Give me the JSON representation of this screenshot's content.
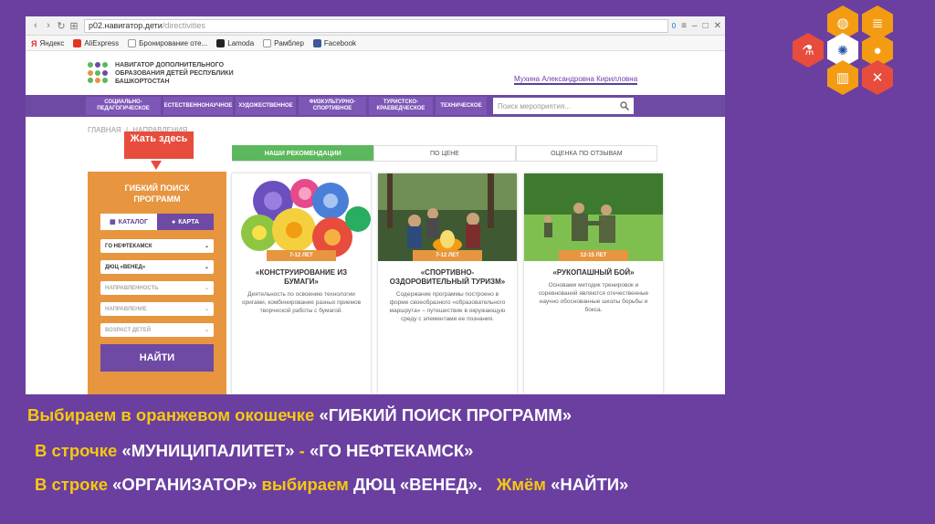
{
  "browser": {
    "url_host": "p02.навигатор.дети",
    "url_path": "/directivities",
    "bookmarks": [
      "Яндекс",
      "AliExpress",
      "Бронирование оте...",
      "Lamoda",
      "Рамблер",
      "Facebook"
    ],
    "counter": "0"
  },
  "site": {
    "logo_line1": "НАВИГАТОР ДОПОЛНИТЕЛЬНОГО",
    "logo_line2": "ОБРАЗОВАНИЯ ДЕТЕЙ РЕСПУБЛИКИ",
    "logo_line3": "БАШКОРТОСТАН",
    "user_name": "Мухина Александровна Кирилловна"
  },
  "categories": [
    "Социально-педагогическое",
    "Естественнонаучное",
    "Художественное",
    "Физкультурно-спортивное",
    "Туристско-краеведческое",
    "Техническое"
  ],
  "search": {
    "placeholder": "Поиск мероприятия..."
  },
  "breadcrumb": {
    "home": "ГЛАВНАЯ",
    "sep": "|",
    "current": "НАПРАВЛЕНИЯ"
  },
  "annotation": "Жать здесь",
  "sidebar": {
    "title": "ГИБКИЙ ПОИСК ПРОГРАММ",
    "catalog": "КАТАЛОГ",
    "map": "КАРТА",
    "municipality": "ГО НЕФТЕКАМСК",
    "organizer": "ДЮЦ «ВЕНЕД»",
    "direction": "НАПРАВЛЕННОСТЬ",
    "branch": "НАПРАВЛЕНИЕ",
    "age": "ВОЗРАСТ ДЕТЕЙ",
    "find": "НАЙТИ"
  },
  "tabs": [
    "НАШИ РЕКОМЕНДАЦИИ",
    "ПО ЦЕНЕ",
    "ОЦЕНКА ПО ОТЗЫВАМ"
  ],
  "cards": [
    {
      "age": "7-12 ЛЕТ",
      "title": "«КОНСТРУИРОВАНИЕ ИЗ БУМАГИ»",
      "desc": "Деятельность по освоению технологии оригами, комбинирование разных приемов творческой работы с бумагой."
    },
    {
      "age": "7-12 ЛЕТ",
      "title": "«СПОРТИВНО-ОЗДОРОВИТЕЛЬНЫЙ ТУРИЗМ»",
      "desc": "Содержание программы построено в форме своеобразного «образовательного маршрута» – путешествие в окружающую среду с элементами ее познания."
    },
    {
      "age": "12-15 ЛЕТ",
      "title": "«РУКОПАШНЫЙ БОЙ»",
      "desc": "Основами методик тренировок и соревнований являются отечественные научно обоснованные школы борьбы и бокса."
    }
  ],
  "instructions": {
    "line1_a": "Выбираем в оранжевом окошечке ",
    "line1_b": "«ГИБКИЙ ПОИСК ПРОГРАММ»",
    "line2_a": "В строчке ",
    "line2_b": "«МУНИЦИПАЛИТЕТ»",
    "line2_c": " - ",
    "line2_d": "«ГО НЕФТЕКАМСК»",
    "line3_a": "В строке ",
    "line3_b": "«ОРГАНИЗАТОР»",
    "line3_c": " выбираем ",
    "line3_d": "ДЮЦ «ВЕНЕД».",
    "line3_e": "   Жмём ",
    "line3_f": "«НАЙТИ»"
  },
  "colors": {
    "background": "#6a3fa0",
    "orange": "#e7953f",
    "purple": "#6e4aa5",
    "green": "#5cb85c",
    "yellow_text": "#f6c90e"
  }
}
